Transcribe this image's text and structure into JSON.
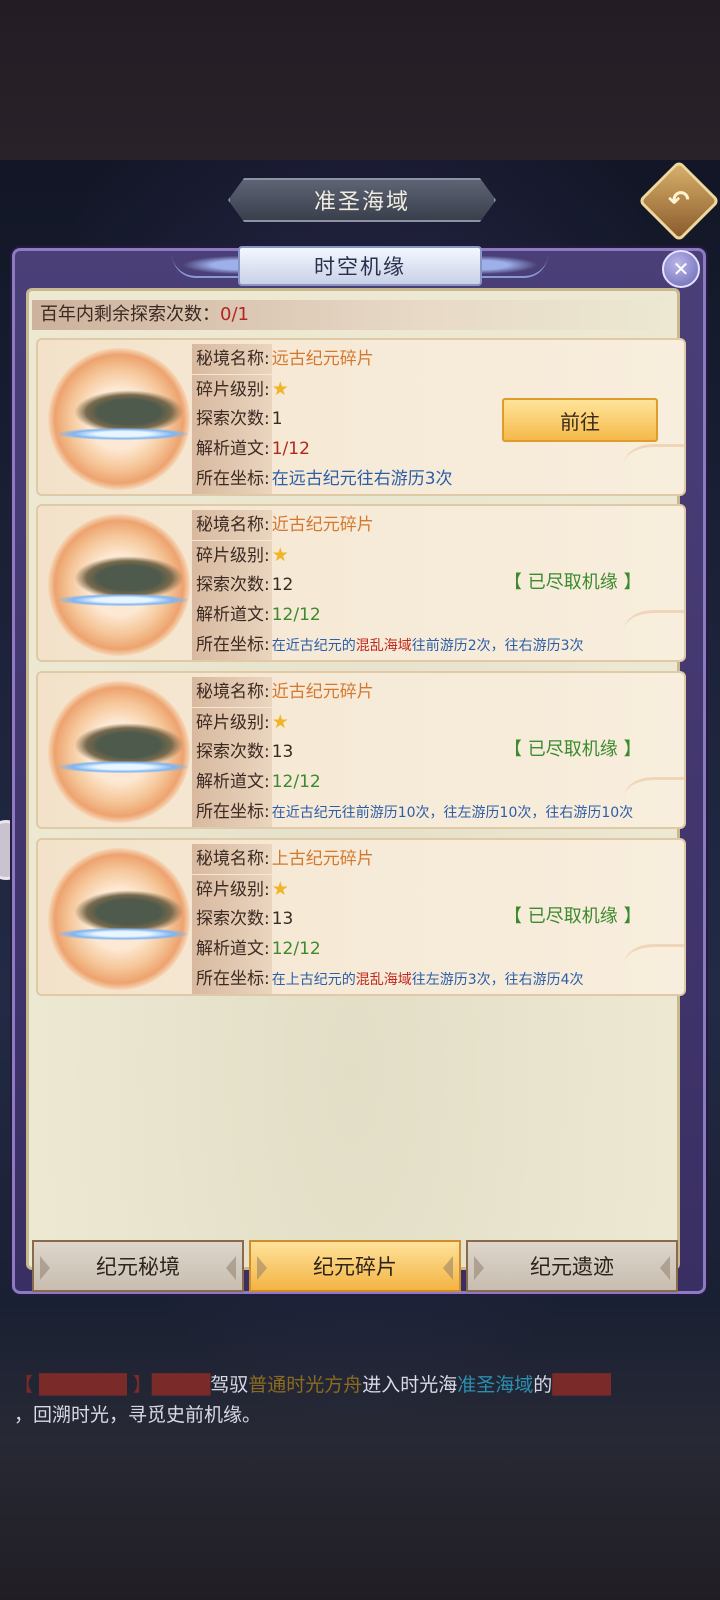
{
  "scene": {
    "title": "准圣海域"
  },
  "dialog": {
    "title": "时空机缘",
    "remaining_label": "百年内剩余探索次数：",
    "remaining_value": "0/1"
  },
  "labels": {
    "name": "秘境名称:",
    "level": "碎片级别:",
    "explore": "探索次数:",
    "decode": "解析道文:",
    "coord": "所在坐标:"
  },
  "cards": [
    {
      "name": "远古纪元碎片",
      "stars": 1,
      "explore": "1",
      "decode": "1/12",
      "coord": "在远古纪元往右游历3次",
      "action": "前往"
    },
    {
      "name": "近古纪元碎片",
      "stars": 1,
      "explore": "12",
      "decode": "12/12",
      "coord_a": "在近古纪元的",
      "coord_b": "混乱海域",
      "coord_c": "往前游历2次，往右游历3次",
      "status": "【 已尽取机缘 】"
    },
    {
      "name": "近古纪元碎片",
      "stars": 1,
      "explore": "13",
      "decode": "12/12",
      "coord": "在近古纪元往前游历10次，往左游历10次，往右游历10次",
      "status": "【 已尽取机缘 】"
    },
    {
      "name": "上古纪元碎片",
      "stars": 1,
      "explore": "13",
      "decode": "12/12",
      "coord_a": "在上古纪元的",
      "coord_b": "混乱海域",
      "coord_c": "往左游历3次，往右游历4次",
      "status": "【 已尽取机缘 】"
    }
  ],
  "tabs": [
    "纪元秘境",
    "纪元碎片",
    "纪元遗迹"
  ],
  "chat": {
    "prefix": "【 ██████ 】████",
    "t1": "驾驭",
    "vehicle": "普通时光方舟",
    "t2": "进入时光海",
    "location": "准圣海域",
    "t3": "的",
    "sublocation": "████",
    "t4": "，回溯时光，寻觅史前机缘。"
  }
}
